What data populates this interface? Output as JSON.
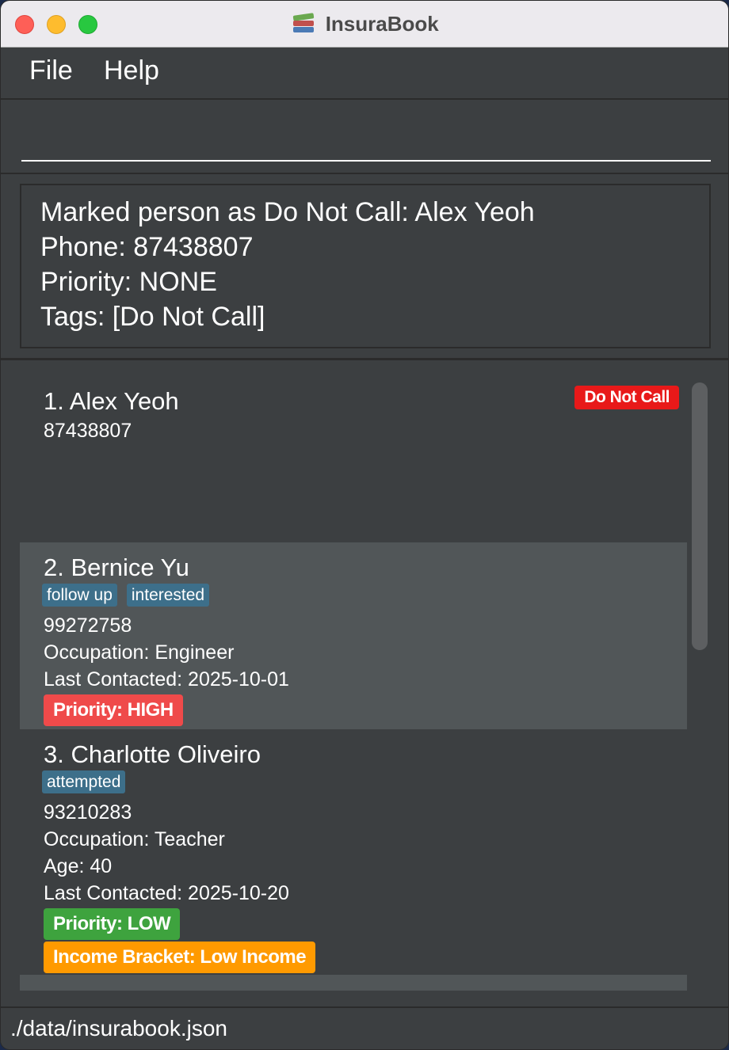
{
  "window": {
    "title": "InsuraBook",
    "app_icon": "books-icon"
  },
  "menu": {
    "file": "File",
    "help": "Help"
  },
  "command": {
    "value": "",
    "placeholder": ""
  },
  "result": {
    "lines": [
      "Marked person as Do Not Call: Alex Yeoh",
      "Phone: 87438807",
      "Priority: NONE",
      "Tags: [Do Not Call]"
    ]
  },
  "persons": [
    {
      "name": "1. Alex Yeoh",
      "phone": "87438807",
      "badge": "Do Not Call",
      "badge_color": "#e81919"
    },
    {
      "name": "2. Bernice Yu",
      "tags": [
        "follow up",
        "interested"
      ],
      "phone": "99272758",
      "occupation": "Occupation: Engineer",
      "last_contacted": "Last Contacted: 2025-10-01",
      "priority": "Priority: HIGH",
      "priority_color": "#ef4a4a",
      "selected": true
    },
    {
      "name": "3. Charlotte Oliveiro",
      "tags": [
        "attempted"
      ],
      "phone": "93210283",
      "occupation": "Occupation: Teacher",
      "age": "Age: 40",
      "last_contacted": "Last Contacted: 2025-10-20",
      "priority": "Priority: LOW",
      "priority_color": "#3ea33e",
      "income": "Income Bracket: Low Income",
      "income_color": "#ff9a00"
    }
  ],
  "status": {
    "file_path": "./data/insurabook.json"
  }
}
